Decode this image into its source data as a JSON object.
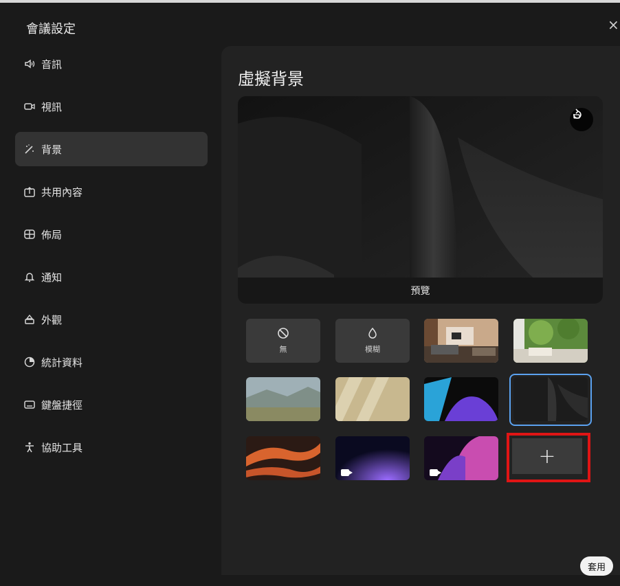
{
  "dialog": {
    "title": "會議設定",
    "close": "×"
  },
  "sidebar": {
    "items": [
      {
        "label": "音訊",
        "icon": "speaker-icon"
      },
      {
        "label": "視訊",
        "icon": "video-icon"
      },
      {
        "label": "背景",
        "icon": "magic-wand-icon",
        "active": true
      },
      {
        "label": "共用內容",
        "icon": "share-icon"
      },
      {
        "label": "佈局",
        "icon": "layout-grid-icon"
      },
      {
        "label": "通知",
        "icon": "bell-icon"
      },
      {
        "label": "外觀",
        "icon": "appearance-icon"
      },
      {
        "label": "統計資料",
        "icon": "statistics-icon"
      },
      {
        "label": "鍵盤捷徑",
        "icon": "keyboard-icon"
      },
      {
        "label": "協助工具",
        "icon": "accessibility-icon"
      }
    ]
  },
  "panel": {
    "title": "虛擬背景",
    "preview_label": "預覽",
    "tiles": {
      "none_label": "無",
      "blur_label": "模糊",
      "add_symbol": "+"
    },
    "apply_label": "套用"
  },
  "colors": {
    "background": "#1a1a1a",
    "panel": "#222222",
    "active_nav": "#333333",
    "selection_blue": "#5ba2f0",
    "highlight_red": "#e01515"
  }
}
